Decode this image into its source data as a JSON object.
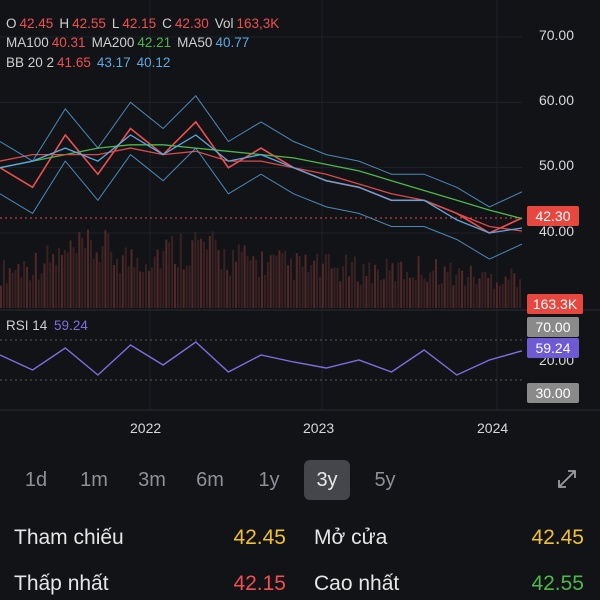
{
  "legend": {
    "ohlc": [
      {
        "key": "O",
        "value": "42.45",
        "color": "#f04f4f"
      },
      {
        "key": "H",
        "value": "42.55",
        "color": "#f04f4f"
      },
      {
        "key": "L",
        "value": "42.15",
        "color": "#f04f4f"
      },
      {
        "key": "C",
        "value": "42.30",
        "color": "#f04f4f"
      },
      {
        "key": "Vol",
        "value": "163,3K",
        "color": "#f04f4f"
      }
    ],
    "ma": [
      {
        "key": "MA100",
        "value": "40.31",
        "color": "#f04f4f"
      },
      {
        "key": "MA200",
        "value": "42.21",
        "color": "#4cb84a"
      },
      {
        "key": "MA50",
        "value": "40.77",
        "color": "#5aa8e0"
      }
    ],
    "bb": {
      "key": "BB 20 2",
      "values": [
        {
          "value": "41.65",
          "color": "#f04f4f"
        },
        {
          "value": "43.17",
          "color": "#5aa8e0"
        },
        {
          "value": "40.12",
          "color": "#5aa8e0"
        }
      ]
    },
    "rsi": {
      "key": "RSI 14",
      "value": "59.24",
      "color": "#7f6ee0"
    }
  },
  "price_axis": [
    "70.00",
    "60.00",
    "50.00",
    "40.00"
  ],
  "rsi_axis": [
    "70.00",
    "20.00"
  ],
  "badges": {
    "price": {
      "text": "42.30",
      "color": "#e8473f"
    },
    "volume": {
      "text": "163.3K",
      "color": "#e8473f"
    },
    "rsi_upper": {
      "text": "70.00",
      "color": "#8a8a8a"
    },
    "rsi_value": {
      "text": "59.24",
      "color": "#6f5ad6"
    },
    "rsi_lower": {
      "text": "30.00",
      "color": "#8a8a8a"
    }
  },
  "time_axis": [
    "2022",
    "2023",
    "2024"
  ],
  "ranges": {
    "items": [
      "1d",
      "1m",
      "3m",
      "6m",
      "1y",
      "3y",
      "5y"
    ],
    "active": "3y"
  },
  "stats": {
    "reference": {
      "label": "Tham chiếu",
      "value": "42.45"
    },
    "open": {
      "label": "Mở cửa",
      "value": "42.45"
    },
    "low": {
      "label": "Thấp nhất",
      "value": "42.15"
    },
    "high": {
      "label": "Cao nhất",
      "value": "42.55"
    }
  },
  "chart_data": {
    "type": "line",
    "x": [
      "2021-07",
      "2021-09",
      "2021-11",
      "2022-01",
      "2022-03",
      "2022-05",
      "2022-07",
      "2022-09",
      "2022-11",
      "2023-01",
      "2023-03",
      "2023-05",
      "2023-07",
      "2023-09",
      "2023-11",
      "2024-01",
      "2024-02"
    ],
    "series": [
      {
        "name": "C",
        "values": [
          50,
          47,
          55,
          49,
          56,
          52,
          57,
          50,
          53,
          50,
          48,
          47,
          45,
          45,
          43,
          40,
          42.3
        ]
      },
      {
        "name": "MA200",
        "values": [
          50,
          51,
          52,
          53,
          53.5,
          53.5,
          53,
          52.5,
          52,
          51.5,
          50.5,
          49.5,
          48,
          46.5,
          45,
          43.5,
          42.21
        ]
      },
      {
        "name": "MA100",
        "values": [
          51,
          52,
          52,
          52,
          53,
          52,
          52.5,
          51,
          51,
          50,
          49,
          47.5,
          46,
          45,
          43,
          41,
          40.31
        ]
      },
      {
        "name": "MA50",
        "values": [
          50,
          51,
          53,
          51,
          55,
          52,
          55,
          51,
          52,
          50,
          48,
          47,
          45,
          45,
          42,
          40,
          40.77
        ]
      }
    ],
    "volume": [
      180,
      220,
      260,
      300,
      240,
      280,
      320,
      250,
      230,
      210,
      200,
      190,
      180,
      200,
      170,
      150,
      163.3
    ],
    "rsi": [
      55,
      40,
      62,
      35,
      65,
      45,
      68,
      38,
      55,
      48,
      42,
      50,
      38,
      60,
      35,
      50,
      59.24
    ],
    "ylim": [
      35,
      70
    ],
    "rsi_ylim": [
      0,
      100
    ]
  }
}
